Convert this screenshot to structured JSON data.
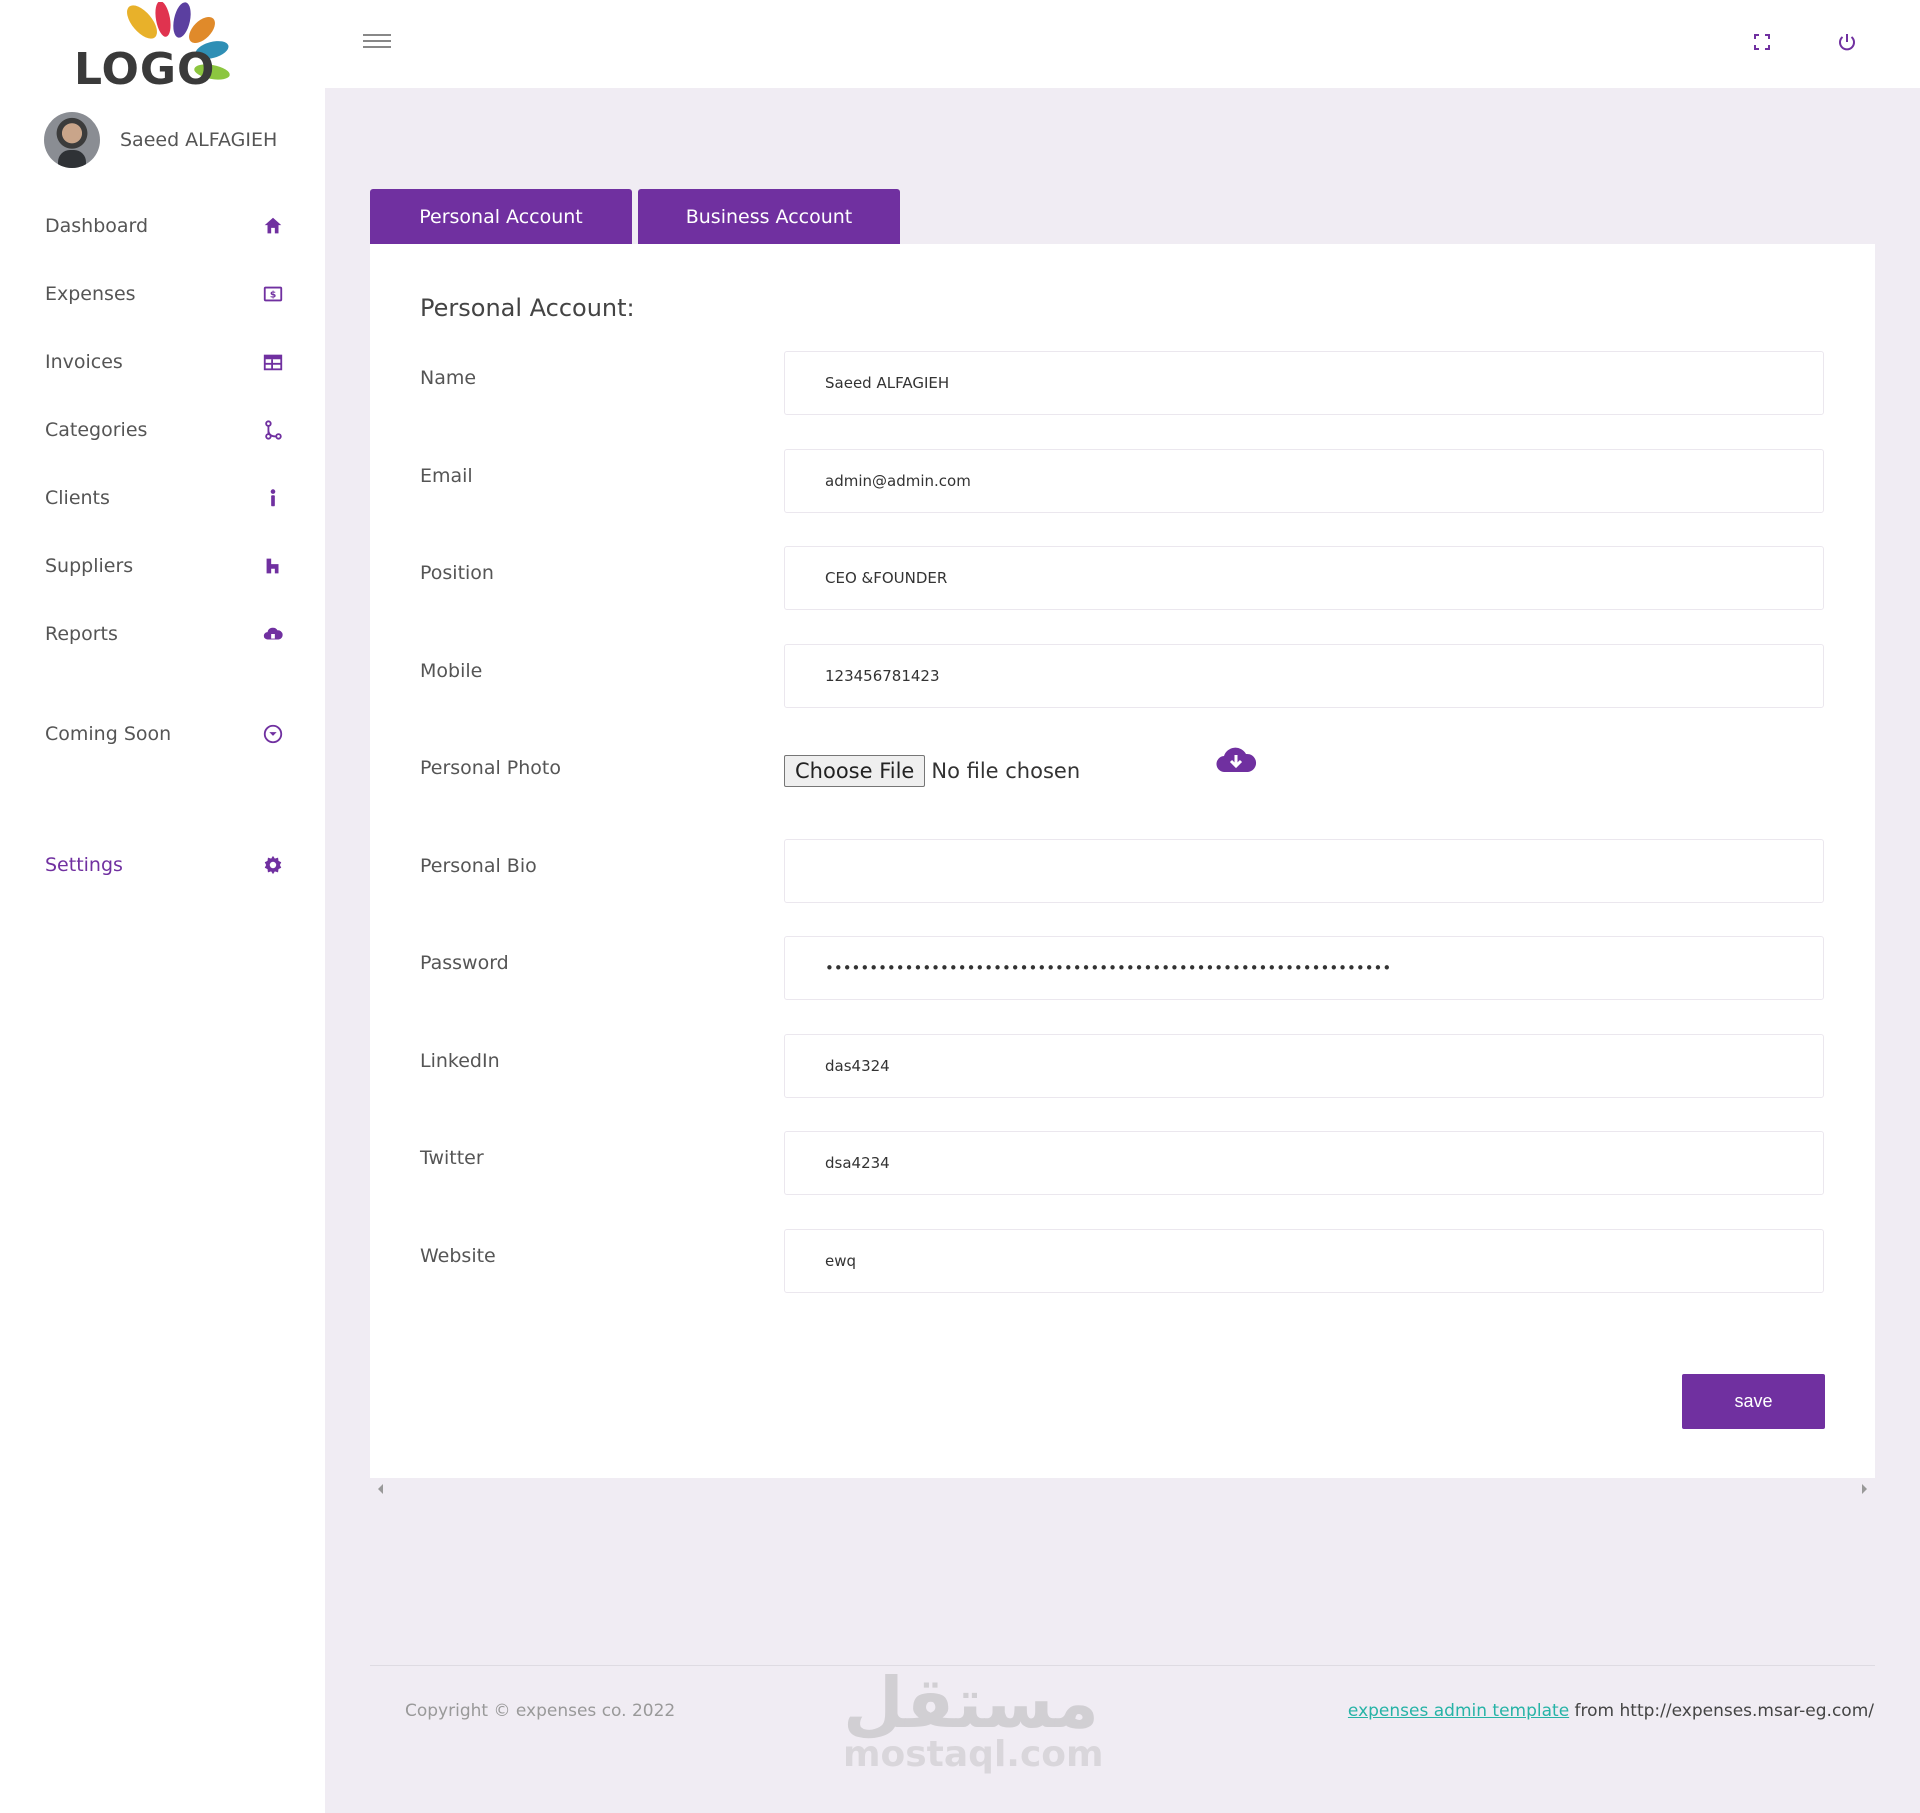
{
  "brand": {
    "logo_text": "LOGO",
    "accent_color": "#7030a0",
    "link_color": "#26b3a6"
  },
  "user": {
    "name": "Saeed ALFAGIEH"
  },
  "sidebar": {
    "items": [
      {
        "label": "Dashboard",
        "icon": "home-icon"
      },
      {
        "label": "Expenses",
        "icon": "money-icon"
      },
      {
        "label": "Invoices",
        "icon": "table-icon"
      },
      {
        "label": "Categories",
        "icon": "branch-icon"
      },
      {
        "label": "Clients",
        "icon": "person-icon"
      },
      {
        "label": "Suppliers",
        "icon": "building-icon"
      },
      {
        "label": "Reports",
        "icon": "cloud-report-icon"
      },
      {
        "label": "Coming Soon",
        "icon": "chevron-circle-down-icon"
      },
      {
        "label": "Settings",
        "icon": "gear-icon",
        "active": true
      }
    ]
  },
  "topbar": {
    "icons": [
      "hamburger-menu-icon",
      "fullscreen-icon",
      "power-icon"
    ]
  },
  "tabs": [
    {
      "label": "Personal Account"
    },
    {
      "label": "Business Account"
    }
  ],
  "form": {
    "title": "Personal Account:",
    "fields": {
      "name": {
        "label": "Name",
        "value": "Saeed ALFAGIEH"
      },
      "email": {
        "label": "Email",
        "value": "admin@admin.com"
      },
      "position": {
        "label": "Position",
        "value": "CEO &FOUNDER"
      },
      "mobile": {
        "label": "Mobile",
        "value": "123456781423"
      },
      "photo": {
        "label": "Personal Photo",
        "button": "Choose File",
        "status": "No file chosen"
      },
      "bio": {
        "label": "Personal Bio",
        "value": ""
      },
      "password": {
        "label": "Password",
        "value": "••••••••••••••••••••••••••••••••••••••••••••••••••••••••••••••••"
      },
      "linkedin": {
        "label": "LinkedIn",
        "value": "das4324"
      },
      "twitter": {
        "label": "Twitter",
        "value": "dsa4234"
      },
      "website": {
        "label": "Website",
        "value": "ewq"
      }
    },
    "save_label": "save"
  },
  "footer": {
    "copyright": "Copyright © expenses co. 2022",
    "link_text": "expenses admin template",
    "link_suffix": " from http://expenses.msar-eg.com/",
    "watermark_ar": "مستقل",
    "watermark_en": "mostaql.com"
  }
}
